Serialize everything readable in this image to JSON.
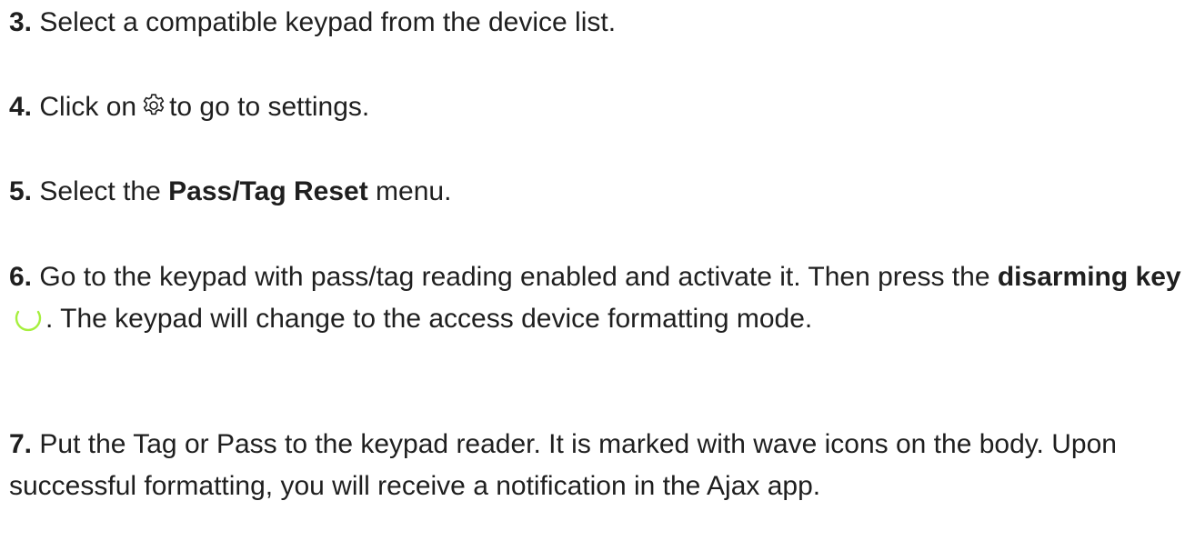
{
  "steps": [
    {
      "number": "3.",
      "text": "Select a compatible keypad from the device list."
    },
    {
      "number": "4.",
      "before": "Click on",
      "icon": "gear-icon",
      "after": "to go to settings."
    },
    {
      "number": "5.",
      "before": "Select the",
      "bold": "Pass/Tag Reset",
      "after": "menu."
    },
    {
      "number": "6.",
      "before": "Go to the keypad with pass/tag reading enabled and activate it. Then press the",
      "bold": "disarming key",
      "icon": "disarm-arc-icon",
      "after": ". The keypad will change to the access device formatting mode."
    },
    {
      "number": "7.",
      "text": "Put the Tag or Pass to the keypad reader. It is marked with wave icons on the body. Upon successful formatting, you will receive a notification in the Ajax app."
    }
  ],
  "colors": {
    "text": "#1f1f1f",
    "disarm_icon": "#a6ef3e"
  }
}
